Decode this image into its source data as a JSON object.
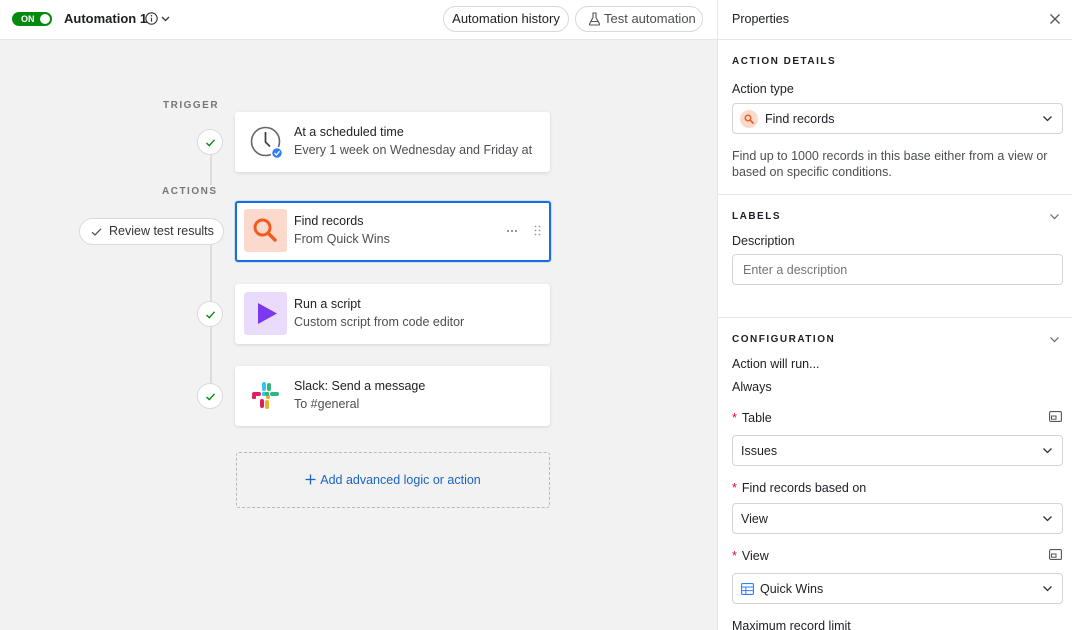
{
  "topbar": {
    "toggle_label": "ON",
    "automation_name": "Automation 1",
    "history_button": "Automation history",
    "test_button": "Test automation"
  },
  "canvas": {
    "trigger_label": "TRIGGER",
    "actions_label": "ACTIONS",
    "review_button": "Review test results",
    "add_button": "Add advanced logic or action",
    "trigger_card": {
      "title": "At a scheduled time",
      "subtitle": "Every 1 week on Wednesday and Friday at ..."
    },
    "steps": [
      {
        "title": "Find records",
        "subtitle": "From Quick Wins",
        "icon": "search-icon"
      },
      {
        "title": "Run a script",
        "subtitle": "Custom script from code editor",
        "icon": "play-icon"
      },
      {
        "title": "Slack: Send a message",
        "subtitle": "To #general",
        "icon": "slack-icon"
      }
    ]
  },
  "panel": {
    "title": "Properties",
    "action_details": {
      "section_title": "ACTION DETAILS",
      "action_type_label": "Action type",
      "action_type_value": "Find records",
      "description": "Find up to 1000 records in this base either from a view or based on specific conditions."
    },
    "labels": {
      "section_title": "LABELS",
      "description_label": "Description",
      "description_placeholder": "Enter a description"
    },
    "configuration": {
      "section_title": "CONFIGURATION",
      "run_label": "Action will run...",
      "run_value": "Always",
      "table_label": "Table",
      "table_value": "Issues",
      "based_on_label": "Find records based on",
      "based_on_value": "View",
      "view_label": "View",
      "view_value": "Quick Wins",
      "limit_label": "Maximum record limit"
    }
  },
  "colors": {
    "toggle_on": "#048a0e",
    "selected_border": "#166ee1",
    "link_blue": "#1a63c2",
    "required": "#dc043b",
    "find_icon_bg": "#fbd9cc",
    "script_icon_bg": "#e9dcfb"
  }
}
